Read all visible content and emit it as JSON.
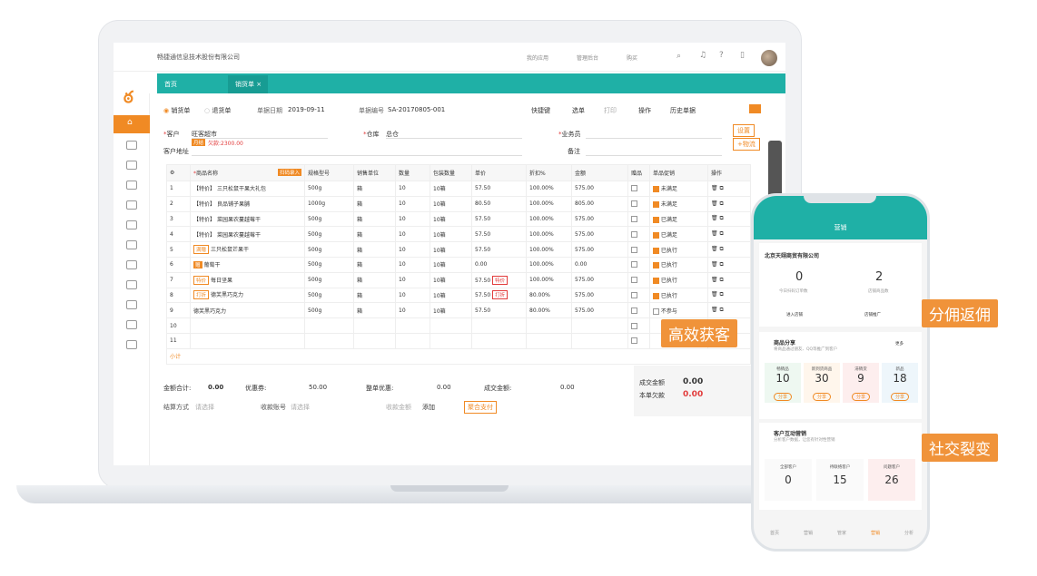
{
  "topbar": {
    "company": "畅捷通信息技术股份有限公司",
    "items": [
      "我的应用",
      "管理后台",
      "购买"
    ],
    "badge": "99"
  },
  "tabs": {
    "home": "首页",
    "sales": "销货单 ×"
  },
  "form": {
    "doc_types": [
      "销货单",
      "退货单"
    ],
    "date_label": "单据日期",
    "date_value": "2019-09-11",
    "no_label": "单据编号",
    "no_value": "SA-20170805-001",
    "toolbar": [
      "快捷键",
      "选单",
      "打印",
      "操作",
      "历史单据"
    ],
    "customer_label": "客户",
    "customer_value": "旺客超市",
    "credit_tag": "月结",
    "debt": "欠款:2300.00",
    "warehouse_label": "仓库",
    "warehouse_value": "总仓",
    "salesman_label": "业务员",
    "address_label": "客户地址",
    "remark_label": "备注",
    "btn_settings": "设置",
    "btn_logistics": "+物流"
  },
  "table": {
    "headers": [
      "商品名称",
      "扫码录入",
      "规格型号",
      "销售单位",
      "数量",
      "包装数量",
      "单价",
      "折扣%",
      "金额",
      "赠品",
      "单品促销",
      "操作"
    ],
    "rows": [
      {
        "n": "1",
        "tag": "【特价】",
        "name": "三只松鼠干果大礼包",
        "spec": "500g",
        "unit": "箱",
        "qty": "10",
        "pack": "10箱",
        "price": "57.50",
        "ptag": "",
        "disc": "100.00%",
        "amt": "575.00",
        "promo": "未满足"
      },
      {
        "n": "2",
        "tag": "【特价】",
        "name": "良品铺子果脯",
        "spec": "1000g",
        "unit": "箱",
        "qty": "10",
        "pack": "10箱",
        "price": "80.50",
        "ptag": "",
        "disc": "100.00%",
        "amt": "805.00",
        "promo": "未满足"
      },
      {
        "n": "3",
        "tag": "【特价】",
        "name": "菜园果农蔓越莓干",
        "spec": "500g",
        "unit": "箱",
        "qty": "10",
        "pack": "10箱",
        "price": "57.50",
        "ptag": "",
        "disc": "100.00%",
        "amt": "575.00",
        "promo": "已满足"
      },
      {
        "n": "4",
        "tag": "【特价】",
        "name": "菜园果农蔓越莓干",
        "spec": "500g",
        "unit": "箱",
        "qty": "10",
        "pack": "10箱",
        "price": "57.50",
        "ptag": "",
        "disc": "100.00%",
        "amt": "575.00",
        "promo": "已满足"
      },
      {
        "n": "5",
        "tag": "满赠",
        "name": "三只松鼠芒果干",
        "spec": "500g",
        "unit": "箱",
        "qty": "10",
        "pack": "10箱",
        "price": "57.50",
        "ptag": "",
        "disc": "100.00%",
        "amt": "575.00",
        "promo": "已执行"
      },
      {
        "n": "6",
        "tag": "赠",
        "name": "葡萄干",
        "spec": "500g",
        "unit": "箱",
        "qty": "10",
        "pack": "10箱",
        "price": "0.00",
        "ptag": "",
        "disc": "100.00%",
        "amt": "0.00",
        "promo": "已执行"
      },
      {
        "n": "7",
        "tag": "特价",
        "name": "每日坚果",
        "spec": "500g",
        "unit": "箱",
        "qty": "10",
        "pack": "10箱",
        "price": "57.50",
        "ptag": "特价",
        "disc": "100.00%",
        "amt": "575.00",
        "promo": "已执行"
      },
      {
        "n": "8",
        "tag": "打折",
        "name": "德芙黑巧克力",
        "spec": "500g",
        "unit": "箱",
        "qty": "10",
        "pack": "10箱",
        "price": "57.50",
        "ptag": "打折",
        "disc": "80.00%",
        "amt": "575.00",
        "promo": "已执行"
      },
      {
        "n": "9",
        "tag": "",
        "name": "德芙黑巧克力",
        "spec": "500g",
        "unit": "箱",
        "qty": "10",
        "pack": "10箱",
        "price": "57.50",
        "ptag": "",
        "disc": "80.00%",
        "amt": "575.00",
        "promo": "不参与"
      },
      {
        "n": "10"
      },
      {
        "n": "11"
      }
    ],
    "subtotal": "小计"
  },
  "totals": {
    "amount_label": "金额合计:",
    "amount": "0.00",
    "coupon_label": "优惠券:",
    "coupon": "50.00",
    "discount_label": "整单优惠:",
    "discount": "0.00",
    "deal_label": "成交金额:",
    "deal": "0.00",
    "settle_label": "结算方式",
    "settle_ph": "请选择",
    "account_label": "收款账号",
    "account_ph": "请选择",
    "received_label": "收款金额",
    "add": "添加",
    "pay": "聚合支付",
    "deal_amount_label": "成交金额",
    "deal_amount": "0.00",
    "debt_label": "本单欠款",
    "debt": "0.00"
  },
  "phone": {
    "title": "营销",
    "company": "北京天翊商贸有限公司",
    "stat1": "0",
    "stat1_label": "今日扫码订单数",
    "stat2": "2",
    "stat2_label": "店铺商品数",
    "enter_shop": "进入店铺",
    "promote_shop": "店铺推广",
    "share_title": "商品分享",
    "share_sub": "将商品通过朋友、QQ等推广到客户",
    "more": "更多",
    "cats": [
      {
        "label": "畅销品",
        "val": "10"
      },
      {
        "label": "新到货商品",
        "val": "30"
      },
      {
        "label": "滞销货",
        "val": "9"
      },
      {
        "label": "新品",
        "val": "18"
      }
    ],
    "share_btn": "分享",
    "interact_title": "客户互动营销",
    "interact_sub": "分析客户数据，让您有针对性营销",
    "cust": [
      {
        "label": "全部客户",
        "val": "0"
      },
      {
        "label": "待联络客户",
        "val": "15"
      },
      {
        "label": "问题客户",
        "val": "26"
      }
    ],
    "nav": [
      "首页",
      "营销",
      "管家",
      "营销",
      "分析"
    ]
  },
  "callouts": {
    "c1": "高效获客",
    "c2": "分佣返佣",
    "c3": "社交裂变"
  },
  "colors": {
    "teal": "#1fb0a6",
    "orange": "#f08a24",
    "red": "#e23b3b"
  }
}
